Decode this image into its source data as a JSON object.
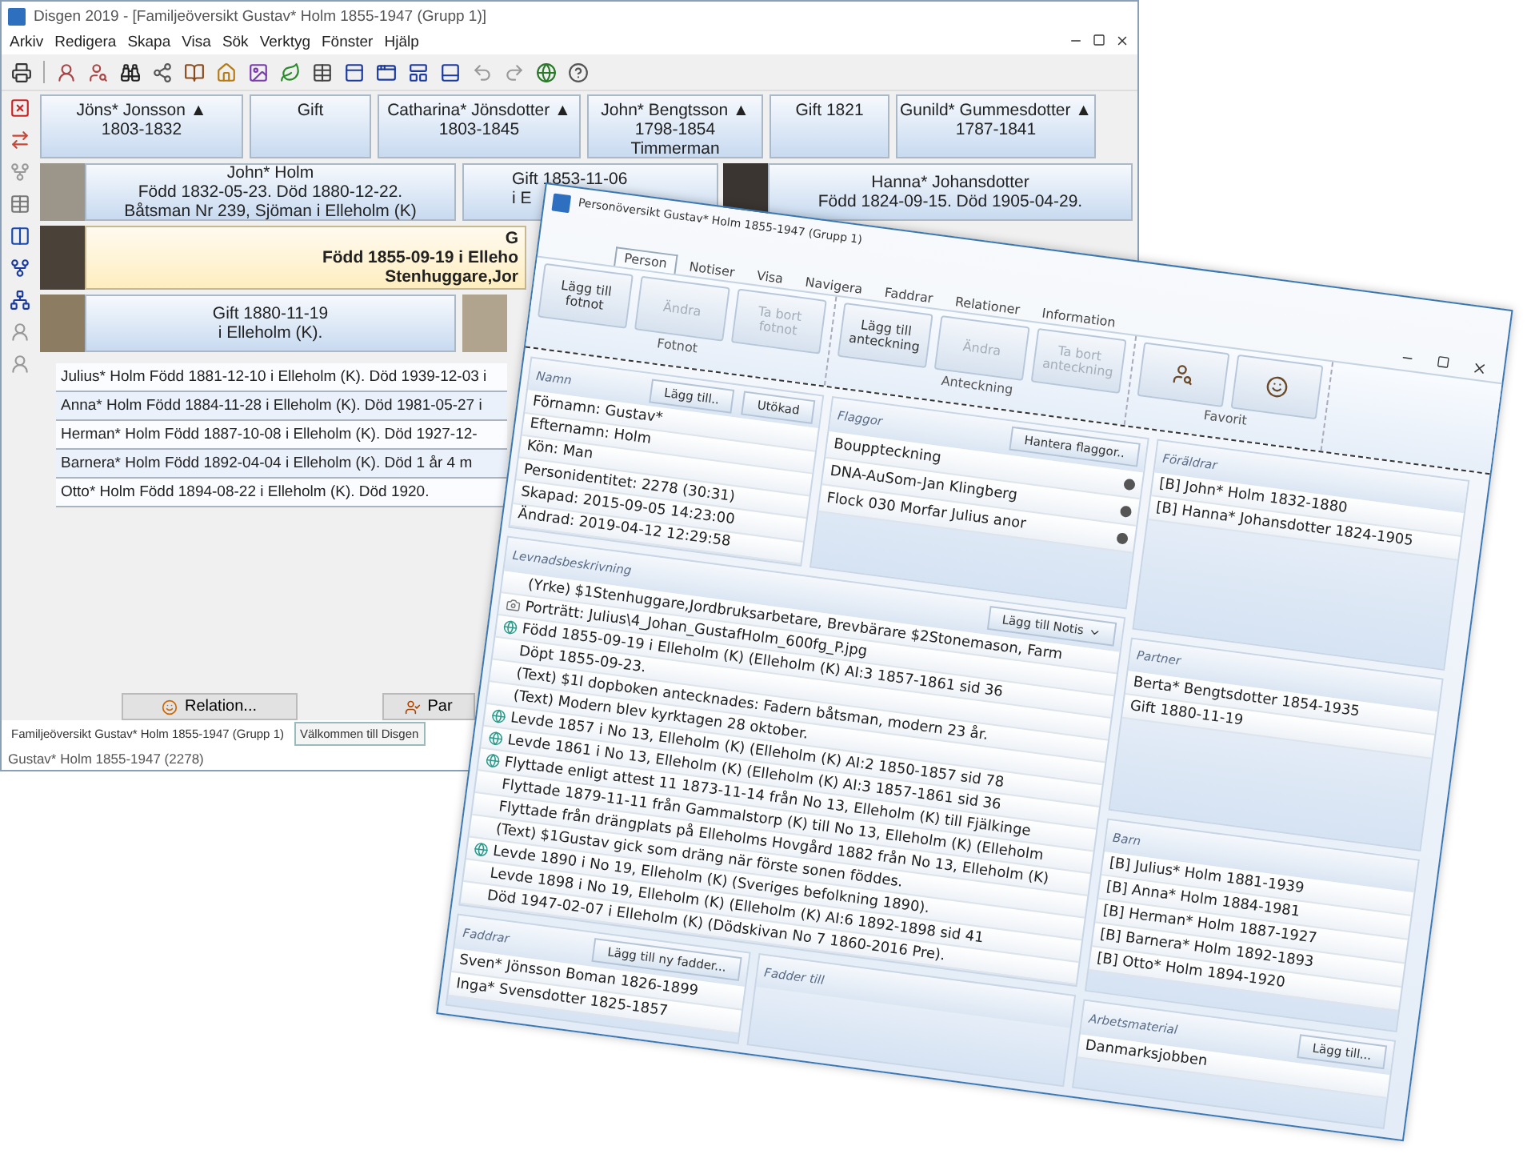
{
  "main_window": {
    "title": "Disgen 2019 - [Familjeöversikt Gustav* Holm 1855-1947 (Grupp 1)]",
    "menu": [
      "Arkiv",
      "Redigera",
      "Skapa",
      "Visa",
      "Sök",
      "Verktyg",
      "Fönster",
      "Hjälp"
    ],
    "grandparents": [
      {
        "lines": [
          "Jöns* Jonsson ▲",
          "1803-1832"
        ]
      },
      {
        "lines": [
          "Gift"
        ]
      },
      {
        "lines": [
          "Catharina* Jönsdotter ▲",
          "1803-1845"
        ]
      },
      {
        "lines": [
          "John* Bengtsson ▲",
          "1798-1854",
          "Timmerman"
        ]
      },
      {
        "lines": [
          "Gift 1821"
        ]
      },
      {
        "lines": [
          "Gunild* Gummesdotter ▲",
          "1787-1841"
        ]
      }
    ],
    "father": {
      "lines": [
        "John* Holm",
        "Född 1832-05-23. Död 1880-12-22.",
        "Båtsman Nr 239, Sjöman  i Elleholm (K)"
      ]
    },
    "parents_marriage": {
      "lines": [
        "Gift 1853-11-06",
        "i E"
      ]
    },
    "mother": {
      "lines": [
        "Hanna* Johansdotter",
        "Född 1824-09-15. Död 1905-04-29."
      ]
    },
    "main_person": {
      "lines": [
        "G",
        "Född 1855-09-19 i Elleho",
        "Stenhuggare,Jor"
      ]
    },
    "marriage": {
      "lines": [
        "Gift 1880-11-19",
        "i Elleholm (K)."
      ]
    },
    "children": [
      "Julius* Holm Född 1881-12-10 i Elleholm (K). Död 1939-12-03 i",
      "Anna* Holm Född 1884-11-28 i Elleholm (K). Död 1981-05-27 i",
      "Herman* Holm Född 1887-10-08 i Elleholm (K). Död 1927-12-",
      "Barnera* Holm Född 1892-04-04 i Elleholm (K). Död 1 år 4 m",
      "Otto* Holm Född 1894-08-22 i Elleholm (K). Död 1920."
    ],
    "buttons": [
      "Relation...",
      "Par"
    ],
    "doc_tabs": [
      {
        "label": "Familjeöversikt Gustav* Holm 1855-1947 (Grupp 1)",
        "selected": false
      },
      {
        "label": "Välkommen till Disgen",
        "selected": true
      }
    ],
    "status": "Gustav* Holm 1855-1947 (2278)"
  },
  "person_window": {
    "title": "Personöversikt Gustav* Holm 1855-1947 (Grupp 1)",
    "tabs": [
      {
        "label": "Person",
        "selected": true
      },
      {
        "label": "Notiser",
        "selected": false
      },
      {
        "label": "Visa",
        "selected": false
      },
      {
        "label": "Navigera",
        "selected": false
      },
      {
        "label": "Faddrar",
        "selected": false
      },
      {
        "label": "Relationer",
        "selected": false
      },
      {
        "label": "Information",
        "selected": false
      }
    ],
    "ribbon_groups": [
      {
        "label": "Fotnot",
        "kind": "text",
        "buttons": [
          {
            "label": "Lägg till fotnot",
            "disabled": false
          },
          {
            "label": "Ändra",
            "disabled": true
          },
          {
            "label": "Ta bort fotnot",
            "disabled": true
          }
        ]
      },
      {
        "label": "Anteckning",
        "kind": "text",
        "buttons": [
          {
            "label": "Lägg till anteckning",
            "disabled": false
          },
          {
            "label": "Ändra",
            "disabled": true
          },
          {
            "label": "Ta bort anteckning",
            "disabled": true
          }
        ]
      },
      {
        "label": "Favorit",
        "kind": "icons",
        "buttons": [
          {
            "disabled": false
          },
          {
            "disabled": false
          }
        ]
      }
    ],
    "name_panel": {
      "title": "Namn",
      "buttons": [
        "Lägg till..",
        "Utökad"
      ],
      "rows": [
        "Förnamn: Gustav*",
        "Efternamn: Holm",
        "Kön: Man",
        "Personidentitet: 2278 (30:31)",
        "Skapad:  2015-09-05   14:23:00",
        "Ändrad:  2019-04-12   12:29:58"
      ]
    },
    "flags_panel": {
      "title": "Flaggor",
      "button": "Hantera flaggor..",
      "items": [
        "Bouppteckning",
        "DNA-AuSom-Jan Klingberg",
        "Flock 030 Morfar Julius anor"
      ]
    },
    "life_panel": {
      "title": "Levnadsbeskrivning",
      "button": "Lägg till Notis",
      "entries": [
        {
          "kind": "plain",
          "text": "(Yrke) $1Stenhuggare,Jordbruksarbetare, Brevbärare  $2Stonemason, Farm"
        },
        {
          "kind": "portrait",
          "text": "Porträtt:  Julius\\4_Johan_GustafHolm_600fg_P.jpg"
        },
        {
          "kind": "place",
          "text": "Född 1855-09-19 i Elleholm (K) (Elleholm (K) AI:3 1857-1861 sid  36"
        },
        {
          "kind": "plain",
          "text": "Döpt 1855-09-23."
        },
        {
          "kind": "plain",
          "text": "(Text) $1I dopboken antecknades: Fadern båtsman, modern 23 år."
        },
        {
          "kind": "plain",
          "text": "(Text) Modern blev kyrktagen 28 oktober."
        },
        {
          "kind": "place",
          "text": "Levde 1857 i No 13, Elleholm (K) (Elleholm (K) AI:2 1850-1857 sid  78"
        },
        {
          "kind": "place",
          "text": "Levde 1861 i No 13, Elleholm (K) (Elleholm (K) AI:3 1857-1861 sid  36"
        },
        {
          "kind": "place",
          "text": "Flyttade enligt attest 11 1873-11-14 från No 13, Elleholm (K) till Fjälkinge"
        },
        {
          "kind": "plain",
          "text": "Flyttade 1879-11-11 från Gammalstorp (K) till No 13, Elleholm (K) (Elleholm"
        },
        {
          "kind": "plain",
          "text": "Flyttade från drängplats på Elleholms Hovgård 1882 från No 13, Elleholm (K)"
        },
        {
          "kind": "plain",
          "text": "(Text) $1Gustav gick som dräng när förste sonen föddes."
        },
        {
          "kind": "place",
          "text": "Levde 1890 i No 19, Elleholm (K) (Sveriges befolkning 1890)."
        },
        {
          "kind": "plain",
          "text": "Levde 1898 i No 19, Elleholm (K) (Elleholm (K) AI:6 1892-1898 sid  41"
        },
        {
          "kind": "plain",
          "text": "Död 1947-02-07 i Elleholm (K) (Dödskivan No 7 1860-2016 Pre)."
        }
      ]
    },
    "godparents_panel": {
      "title": "Faddrar",
      "button": "Lägg till ny fadder...",
      "items": [
        "Sven* Jönsson Boman 1826-1899",
        "Inga* Svensdotter 1825-1857"
      ]
    },
    "godchild_panel": {
      "title": "Fadder till"
    },
    "parents_panel": {
      "title": "Föräldrar",
      "items": [
        "[B] John*  Holm  1832-1880",
        "[B] Hanna*  Johansdotter  1824-1905"
      ]
    },
    "partner_panel": {
      "title": "Partner",
      "items": [
        "Berta*  Bengtsdotter  1854-1935",
        "Gift 1880-11-19"
      ]
    },
    "children_panel": {
      "title": "Barn",
      "items": [
        "[B] Julius*  Holm  1881-1939",
        "[B] Anna*  Holm  1884-1981",
        "[B] Herman*  Holm  1887-1927",
        "[B] Barnera*  Holm  1892-1893",
        "[B] Otto*  Holm  1894-1920"
      ]
    },
    "work_panel": {
      "title": "Arbetsmaterial",
      "button": "Lägg till...",
      "items": [
        "Danmarksjobben"
      ]
    }
  }
}
